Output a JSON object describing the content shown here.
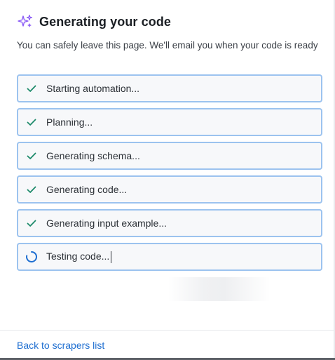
{
  "header": {
    "icon": "sparkle-icon",
    "title": "Generating your code"
  },
  "subtitle": "You can safely leave this page. We'll email you when your code is ready",
  "steps": [
    {
      "label": "Starting automation...",
      "status": "done",
      "icon": "check-icon"
    },
    {
      "label": "Planning...",
      "status": "done",
      "icon": "check-icon"
    },
    {
      "label": "Generating schema...",
      "status": "done",
      "icon": "check-icon"
    },
    {
      "label": "Generating code...",
      "status": "done",
      "icon": "check-icon"
    },
    {
      "label": "Generating input example...",
      "status": "done",
      "icon": "check-icon"
    },
    {
      "label": "Testing code...",
      "status": "in-progress",
      "icon": "spinner-icon"
    }
  ],
  "footer": {
    "back_link": "Back to scrapers list"
  },
  "colors": {
    "accent_purple": "#8b5cf6",
    "check_green": "#1d8a6a",
    "spinner_blue": "#1f6fd1",
    "step_border": "#9cc3ef",
    "link_blue": "#1f6fd1"
  }
}
